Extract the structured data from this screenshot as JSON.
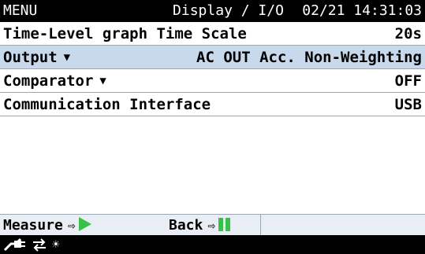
{
  "header": {
    "menu_label": "MENU",
    "screen_title": "Display / I/O",
    "datetime": "02/21 14:31:03"
  },
  "settings": [
    {
      "label": "Time-Level graph Time Scale",
      "value": "20s",
      "has_dropdown": false,
      "selected": false
    },
    {
      "label": "Output",
      "value": "AC OUT Acc. Non-Weighting",
      "has_dropdown": true,
      "selected": true
    },
    {
      "label": "Comparator",
      "value": "OFF",
      "has_dropdown": true,
      "selected": false
    },
    {
      "label": "Communication Interface",
      "value": "USB",
      "has_dropdown": false,
      "selected": false
    }
  ],
  "footer": {
    "measure_label": "Measure",
    "back_label": "Back",
    "play_icon": "play-icon",
    "pause_icon": "pause-icon"
  },
  "status_icons": [
    "power-plug-icon",
    "usb-transfer-icon",
    "backlight-icon"
  ],
  "colors": {
    "titlebar_bg": "#000000",
    "selected_row_bg": "#c9d9ec",
    "footer_bg": "#e9eef5",
    "accent_green": "#35c14a"
  }
}
